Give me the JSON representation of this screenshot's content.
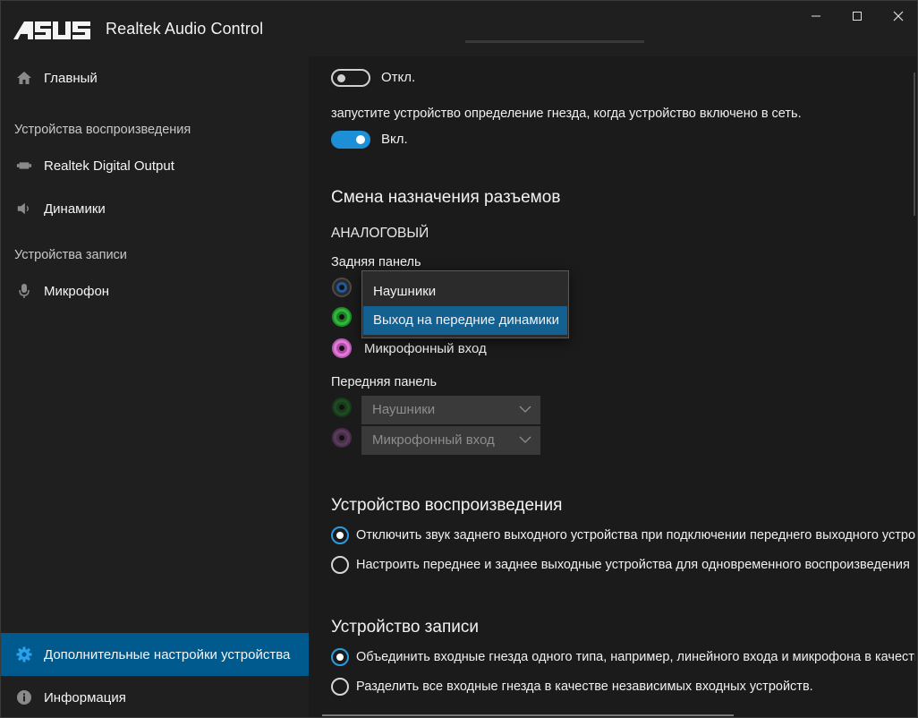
{
  "titlebar": {
    "brand": "ASUS",
    "app_title": "Realtek Audio Control"
  },
  "sidebar": {
    "home_label": "Главный",
    "playback_header": "Устройства воспроизведения",
    "digital_output_label": "Realtek Digital Output",
    "speakers_label": "Динамики",
    "recording_header": "Устройства записи",
    "microphone_label": "Микрофон",
    "advanced_label": "Дополнительные настройки устройства",
    "info_label": "Информация"
  },
  "main": {
    "toggle1_state_label": "Откл.",
    "toggle2_description": "запустите устройство определение гнезда, когда  устройство включено в сеть.",
    "toggle2_state_label": "Вкл.",
    "reassign_title": "Смена назначения разъемов",
    "analog_label": "АНАЛОГОВЫЙ",
    "rear_panel_label": "Задняя панель",
    "rear_mic_label": "Микрофонный вход",
    "front_panel_label": "Передняя панель",
    "front_select1_value": "Наушники",
    "front_select2_value": "Микрофонный вход",
    "playback_section_title": "Устройство воспроизведения",
    "playback_option1": "Отключить звук заднего выходного устройства при подключении переднего выходного устройства",
    "playback_option2": "Настроить переднее и заднее выходные устройства для одновременного воспроизведения",
    "recording_section_title": "Устройство записи",
    "recording_option1": "Объединить входные гнезда одного типа, например, линейного входа и микрофона в качестве",
    "recording_option2": "Разделить все входные гнезда в качестве независимых входных устройств."
  },
  "dropdown_popup": {
    "option1": "Наушники",
    "option2": "Выход на передние динамики"
  },
  "colors": {
    "accent": "#005a8e",
    "toggle_on": "#1c8fd6",
    "jack_blue": "#1e5a9e",
    "jack_green": "#2fb83a",
    "jack_pink": "#e07ad6"
  }
}
